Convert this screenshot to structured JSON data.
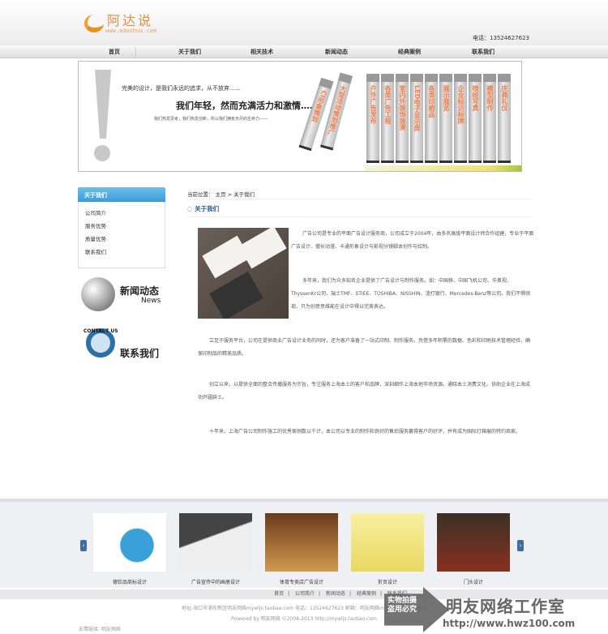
{
  "header": {
    "logo_name": "阿达说",
    "logo_url": "www.adashuo.com",
    "phone": "电话：13524627623"
  },
  "nav": [
    "首页",
    "关于我们",
    "相关技术",
    "新闻动态",
    "经典案例",
    "联系我们"
  ],
  "banner": {
    "line1": "完美的设计，是我们永远的追求，从不放弃……",
    "line2": "我们年轻，然而充满活力和激情……",
    "line3": "我们热爱思考，我们热爱创新，所以我们拥有无尽的生命力——",
    "books": [
      "CI形象策划",
      "大型活动策划推广",
      "户外广告发布",
      "各类广告工程",
      "室内外装饰装潢",
      "LED电子显示屏",
      "各类印刷品",
      "展示展览",
      "企业标识标牌",
      "喷绘写真",
      "模型制作",
      "庆典礼仪"
    ]
  },
  "sidebar": {
    "title": "关于我们",
    "items": [
      "公司简介",
      "服务优势",
      "质量优势",
      "联系我们"
    ],
    "news_title": "新闻动态",
    "news_sub": "News",
    "contact_badge": "CONTACT US",
    "contact_title": "联系我们"
  },
  "main": {
    "breadcrumb": "当前位置： 主页 > 关于我们",
    "title": "关于我们",
    "paragraphs": [
      "广告公司是专业的平面广告设计服务商，公司成立于2004年，由多名高级平面设计师合作组建，专业于平面广告设计、擅长动漫、卡通形象设计与影视分镜脚本创作与绘制。",
      "多年来，我们为众多知名企业提供了广告设计与制作服务。如：中国移、中国飞机公司、华奥视、ThyssenKr公司、瑞士TMF、STIEE、TOSHIBA、NISSHIN、渣打银行、Mercedes-Benz等公司。我们不惧烦琐，只为创意思维能在设计中得以完美表达。",
      "立足于服务平台，公司在提供商业广告设计业务的同时，还为客户准备了一站式印制、制作服务。凭借多年积累的数据、色彩和印刷技术管理经验，确保印制品的精美品质。",
      "创立以来，以提供全面的整合传播服务为宗旨，专注服务上海本土的客户和品牌，深刻细作上海本地市场资源。通晓本土消费文化，协助企业在上海成功开疆辟土。",
      "十年来，上海广告公司制作施工的优秀案例数以千计，本公司以专业的制作和良好的售后服务赢得客户的好评，并有成为国际灯箱展的特约商家。"
    ]
  },
  "cases": [
    "德钦品商标设计",
    "广告宣传中的画册设计",
    "体育专卖店广告设计",
    "折页设计",
    "门头设计"
  ],
  "footer": {
    "links": [
      "首页",
      "公司简介",
      "新闻动态",
      "经典案例",
      "联系我们"
    ],
    "address": "地址:海口市浦东新区明友网络mywljs.taobao.com 电话：13524627623 邮箱：明友网络mywljs.taobao.com",
    "powered": "Powered by 明友网络 ©2008-2013 http://mywljs.taobao.com",
    "friend_links": "友情链接:   明友网络"
  },
  "watermark": {
    "line1": "实物拍摄",
    "line2": "盗用必究",
    "brand": "明友网络工作室",
    "url": "http://www.hwz100.com"
  }
}
